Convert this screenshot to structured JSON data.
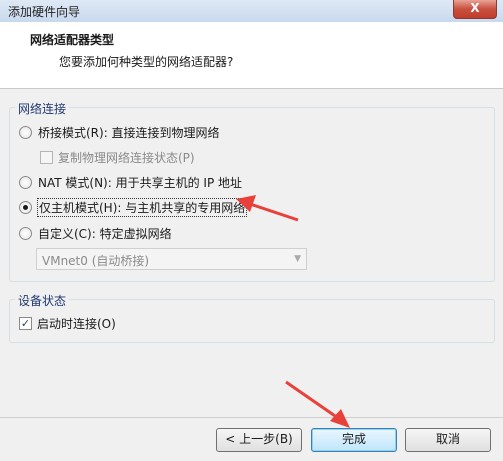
{
  "window": {
    "title": "添加硬件向导",
    "close_label": "X"
  },
  "header": {
    "title": "网络适配器类型",
    "subtitle": "您要添加何种类型的网络适配器?"
  },
  "network_group": {
    "legend": "网络连接",
    "bridged_label": "桥接模式(R): 直接连接到物理网络",
    "replicate_label": "复制物理网络连接状态(P)",
    "nat_label": "NAT 模式(N): 用于共享主机的 IP 地址",
    "hostonly_label": "仅主机模式(H): 与主机共享的专用网络",
    "custom_label": "自定义(C): 特定虚拟网络",
    "custom_select_value": "VMnet0 (自动桥接)",
    "selected": "hostonly"
  },
  "device_group": {
    "legend": "设备状态",
    "connect_at_poweron_label": "启动时连接(O)",
    "connect_at_poweron_checked": true
  },
  "buttons": {
    "back": "< 上一步(B)",
    "finish": "完成",
    "cancel": "取消"
  },
  "annotation_color": "#e8403a"
}
